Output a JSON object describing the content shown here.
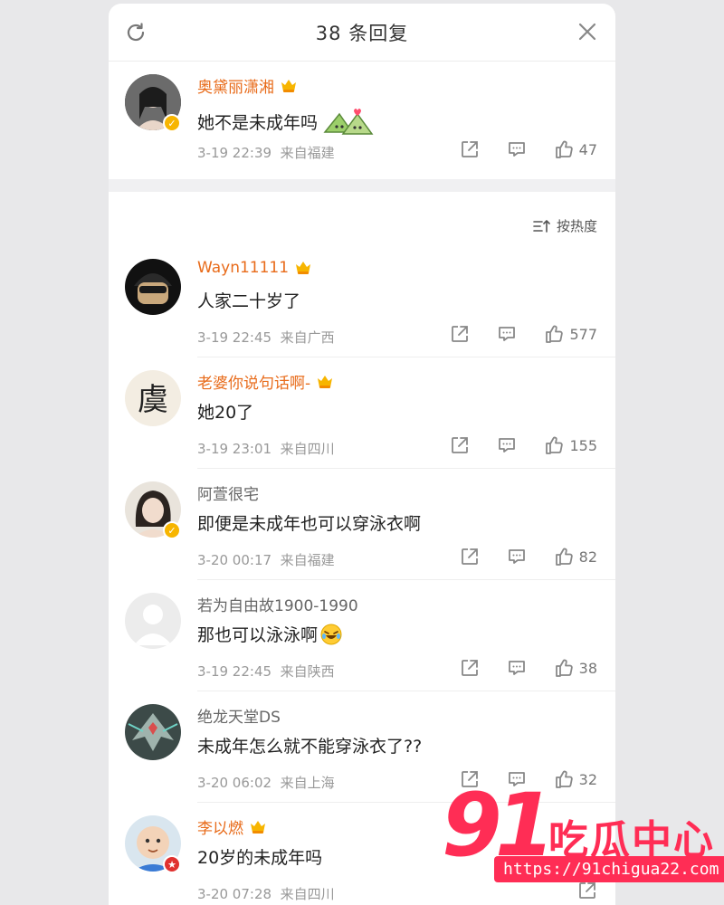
{
  "header": {
    "title": "38 条回复"
  },
  "main_comment": {
    "name": "奥黛丽潇湘",
    "text": "她不是未成年吗",
    "time": "3-19 22:39",
    "location": "来自福建",
    "likes": "47"
  },
  "sort": {
    "label": "按热度"
  },
  "comments": [
    {
      "name": "Wayn11111",
      "text": "人家二十岁了",
      "time": "3-19 22:45",
      "location": "来自广西",
      "likes": "577"
    },
    {
      "name": "老婆你说句话啊-",
      "text": "她20了",
      "time": "3-19 23:01",
      "location": "来自四川",
      "likes": "155"
    },
    {
      "name": "阿萱很宅",
      "text": "即便是未成年也可以穿泳衣啊",
      "time": "3-20 00:17",
      "location": "来自福建",
      "likes": "82"
    },
    {
      "name": "若为自由故1900-1990",
      "text": "那也可以泳泳啊",
      "time": "3-19 22:45",
      "location": "来自陕西",
      "likes": "38"
    },
    {
      "name": "绝龙天堂DS",
      "text": "未成年怎么就不能穿泳衣了??",
      "time": "3-20 06:02",
      "location": "来自上海",
      "likes": "32"
    },
    {
      "name": "李以燃",
      "text": "20岁的未成年吗",
      "time": "3-20 07:28",
      "location": "来自四川",
      "likes": ""
    }
  ],
  "watermark": {
    "brand_number": "91",
    "brand_text": "吃瓜中心",
    "url": "https://91chigua22.com"
  },
  "colors": {
    "accent_orange": "#e86b1a",
    "watermark_red": "#ff2d55",
    "vip_gold": "#f7b500"
  }
}
